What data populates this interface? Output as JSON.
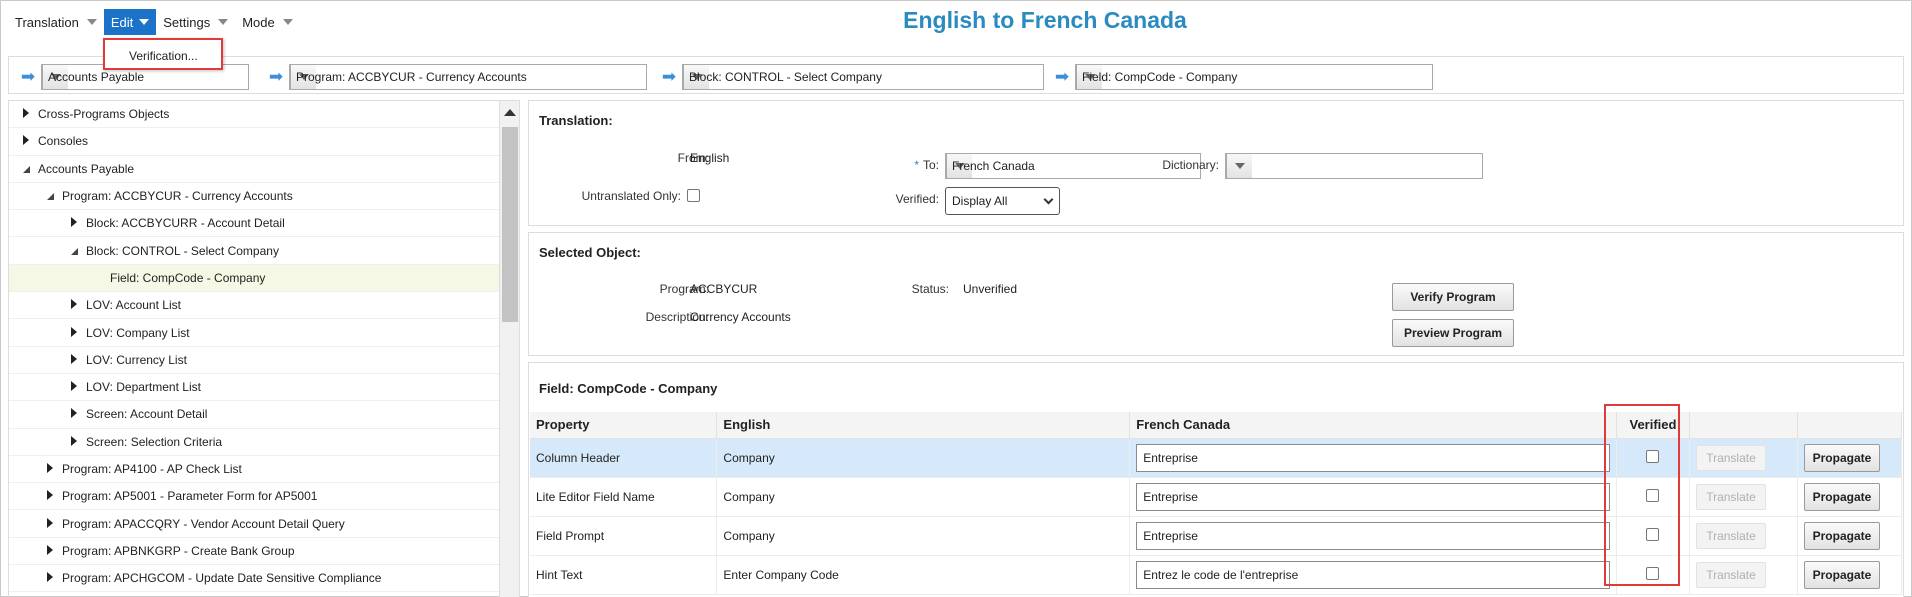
{
  "app_title": "English to French Canada",
  "menu": {
    "items": [
      {
        "name": "translation-menu",
        "label": "Translation",
        "active": false
      },
      {
        "name": "edit-menu",
        "label": "Edit",
        "active": true
      },
      {
        "name": "settings-menu",
        "label": "Settings",
        "active": false
      },
      {
        "name": "mode-menu",
        "label": "Mode",
        "active": false
      }
    ],
    "edit_dropdown": {
      "items": [
        "Verification..."
      ]
    }
  },
  "breadcrumbs": [
    {
      "value": "Accounts Payable"
    },
    {
      "value": "Program: ACCBYCUR - Currency Accounts"
    },
    {
      "value": "Block: CONTROL - Select Company"
    },
    {
      "value": "Field: CompCode - Company"
    }
  ],
  "tree": {
    "items": [
      {
        "label": "Cross-Programs Objects",
        "level": 0,
        "state": "closed"
      },
      {
        "label": "Consoles",
        "level": 0,
        "state": "closed"
      },
      {
        "label": "Accounts Payable",
        "level": 0,
        "state": "open"
      },
      {
        "label": "Program: ACCBYCUR - Currency Accounts",
        "level": 1,
        "state": "open"
      },
      {
        "label": "Block: ACCBYCURR - Account Detail",
        "level": 2,
        "state": "closed"
      },
      {
        "label": "Block: CONTROL - Select Company",
        "level": 2,
        "state": "open"
      },
      {
        "label": "Field: CompCode - Company",
        "level": 3,
        "state": "leaf",
        "selected": true
      },
      {
        "label": "LOV: Account List",
        "level": 2,
        "state": "closed"
      },
      {
        "label": "LOV: Company List",
        "level": 2,
        "state": "closed"
      },
      {
        "label": "LOV: Currency List",
        "level": 2,
        "state": "closed"
      },
      {
        "label": "LOV: Department List",
        "level": 2,
        "state": "closed"
      },
      {
        "label": "Screen: Account Detail",
        "level": 2,
        "state": "closed"
      },
      {
        "label": "Screen: Selection Criteria",
        "level": 2,
        "state": "closed"
      },
      {
        "label": "Program: AP4100 - AP Check List",
        "level": 1,
        "state": "closed"
      },
      {
        "label": "Program: AP5001 - Parameter Form for AP5001",
        "level": 1,
        "state": "closed"
      },
      {
        "label": "Program: APACCQRY - Vendor Account Detail Query",
        "level": 1,
        "state": "closed"
      },
      {
        "label": "Program: APBNKGRP - Create Bank Group",
        "level": 1,
        "state": "closed"
      },
      {
        "label": "Program: APCHGCOM - Update Date Sensitive Compliance",
        "level": 1,
        "state": "closed"
      }
    ]
  },
  "translation": {
    "title": "Translation:",
    "from_label": "From:",
    "from_value": "English",
    "to_required": "*",
    "to_label": "To:",
    "to_value": "French Canada",
    "dictionary_label": "Dictionary:",
    "dictionary_value": "",
    "untranslated_label": "Untranslated Only:",
    "verified_label": "Verified:",
    "verified_value": "Display All"
  },
  "selected_object": {
    "title": "Selected Object:",
    "program_label": "Program:",
    "program_value": "ACCBYCUR",
    "description_label": "Description:",
    "description_value": "Currency Accounts",
    "status_label": "Status:",
    "status_value": "Unverified",
    "verify_button": "Verify Program",
    "preview_button": "Preview Program"
  },
  "field_grid": {
    "title": "Field: CompCode - Company",
    "columns": [
      "Property",
      "English",
      "French Canada",
      "Verified",
      "",
      ""
    ],
    "translate_label": "Translate",
    "propagate_label": "Propagate",
    "rows": [
      {
        "property": "Column Header",
        "english": "Company",
        "french": "Entreprise",
        "verified": false,
        "highlighted": true
      },
      {
        "property": "Lite Editor Field Name",
        "english": "Company",
        "french": "Entreprise",
        "verified": false,
        "highlighted": false
      },
      {
        "property": "Field Prompt",
        "english": "Company",
        "french": "Entreprise",
        "verified": false,
        "highlighted": false
      },
      {
        "property": "Hint Text",
        "english": "Enter Company Code",
        "french": "Entrez le code de l'entreprise",
        "verified": false,
        "highlighted": false
      }
    ]
  },
  "colors": {
    "accent": "#2a8bc2",
    "menu_active": "#1a73c9",
    "highlight_border": "#e03a3a",
    "row_highlight": "#d6e9fb"
  }
}
